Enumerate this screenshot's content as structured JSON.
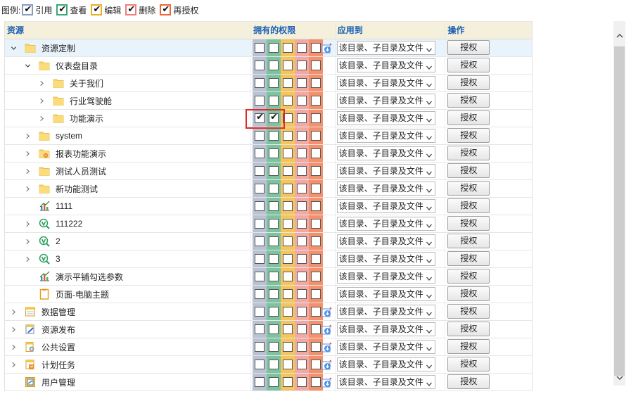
{
  "legend": {
    "label": "图例:",
    "items": [
      {
        "label": "引用",
        "color": "#8a9bc0",
        "checked": true
      },
      {
        "label": "查看",
        "color": "#3aa874",
        "checked": true
      },
      {
        "label": "编辑",
        "color": "#e9b021",
        "checked": true
      },
      {
        "label": "删除",
        "color": "#ef7d78",
        "checked": true
      },
      {
        "label": "再授权",
        "color": "#f0663a",
        "checked": true
      }
    ]
  },
  "headers": {
    "resource": "资源",
    "permissions": "拥有的权限",
    "apply_to": "应用到",
    "operation": "操作"
  },
  "apply_option": "该目录、子目录及文件",
  "grant_label": "授权",
  "rows": [
    {
      "label": "资源定制",
      "level": 0,
      "expander": "down",
      "icon": "folder",
      "inherit": true,
      "checks": [
        false,
        false,
        false,
        false,
        false
      ],
      "selected": true
    },
    {
      "label": "仪表盘目录",
      "level": 1,
      "expander": "down",
      "icon": "folder",
      "inherit": false,
      "checks": [
        false,
        false,
        false,
        false,
        false
      ]
    },
    {
      "label": "关于我们",
      "level": 2,
      "expander": "right",
      "icon": "folder",
      "inherit": false,
      "checks": [
        false,
        false,
        false,
        false,
        false
      ]
    },
    {
      "label": "行业驾驶舱",
      "level": 2,
      "expander": "right",
      "icon": "folder",
      "inherit": false,
      "checks": [
        false,
        false,
        false,
        false,
        false
      ]
    },
    {
      "label": "功能演示",
      "level": 2,
      "expander": "right",
      "icon": "folder",
      "inherit": false,
      "checks": [
        true,
        true,
        false,
        false,
        false
      ]
    },
    {
      "label": "system",
      "level": 1,
      "expander": "right",
      "icon": "folder",
      "inherit": false,
      "checks": [
        false,
        false,
        false,
        false,
        false
      ]
    },
    {
      "label": "报表功能演示",
      "level": 1,
      "expander": "right",
      "icon": "folder-report",
      "inherit": false,
      "checks": [
        false,
        false,
        false,
        false,
        false
      ]
    },
    {
      "label": "测试人员测试",
      "level": 1,
      "expander": "right",
      "icon": "folder",
      "inherit": false,
      "checks": [
        false,
        false,
        false,
        false,
        false
      ]
    },
    {
      "label": "新功能测试",
      "level": 1,
      "expander": "right",
      "icon": "folder",
      "inherit": false,
      "checks": [
        false,
        false,
        false,
        false,
        false
      ]
    },
    {
      "label": "1111",
      "level": 1,
      "expander": "none",
      "icon": "chart",
      "inherit": false,
      "checks": [
        false,
        false,
        false,
        false,
        false
      ]
    },
    {
      "label": "111222",
      "level": 1,
      "expander": "right",
      "icon": "vis",
      "inherit": false,
      "checks": [
        false,
        false,
        false,
        false,
        false
      ]
    },
    {
      "label": "2",
      "level": 1,
      "expander": "right",
      "icon": "vis",
      "inherit": false,
      "checks": [
        false,
        false,
        false,
        false,
        false
      ]
    },
    {
      "label": "3",
      "level": 1,
      "expander": "right",
      "icon": "vis",
      "inherit": false,
      "checks": [
        false,
        false,
        false,
        false,
        false
      ]
    },
    {
      "label": "演示平铺勾选参数",
      "level": 1,
      "expander": "none",
      "icon": "chart",
      "inherit": false,
      "checks": [
        false,
        false,
        false,
        false,
        false
      ]
    },
    {
      "label": "页面-电脑主题",
      "level": 1,
      "expander": "none",
      "icon": "page",
      "inherit": false,
      "checks": [
        false,
        false,
        false,
        false,
        false
      ]
    },
    {
      "label": "数据管理",
      "level": 0,
      "expander": "right",
      "icon": "data-mgmt",
      "inherit": true,
      "checks": [
        false,
        false,
        false,
        false,
        false
      ]
    },
    {
      "label": "资源发布",
      "level": 0,
      "expander": "right",
      "icon": "publish",
      "inherit": true,
      "checks": [
        false,
        false,
        false,
        false,
        false
      ]
    },
    {
      "label": "公共设置",
      "level": 0,
      "expander": "right",
      "icon": "settings",
      "inherit": true,
      "checks": [
        false,
        false,
        false,
        false,
        false
      ]
    },
    {
      "label": "计划任务",
      "level": 0,
      "expander": "right",
      "icon": "schedule",
      "inherit": true,
      "checks": [
        false,
        false,
        false,
        false,
        false
      ]
    },
    {
      "label": "用户管理",
      "level": 0,
      "expander": "none",
      "icon": "user-mgmt",
      "inherit": true,
      "checks": [
        false,
        false,
        false,
        false,
        false
      ]
    }
  ]
}
